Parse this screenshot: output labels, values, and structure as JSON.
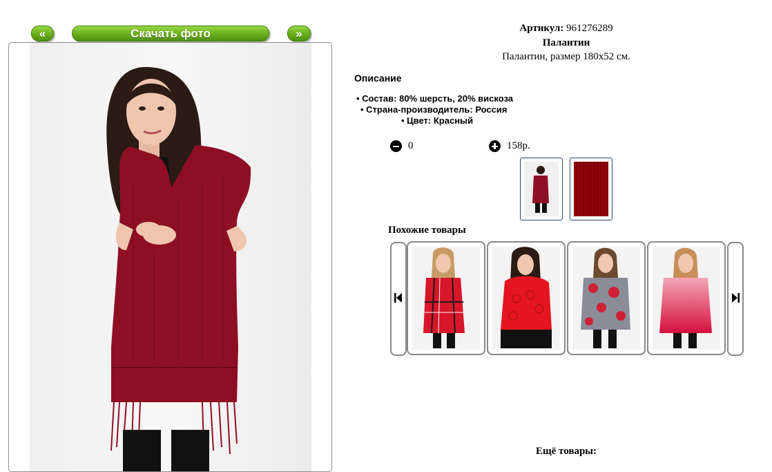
{
  "nav": {
    "prev_label": "«",
    "download_label": "Скачать фото",
    "next_label": "»"
  },
  "product": {
    "article_label": "Артикул:",
    "article_value": "961276289",
    "title": "Палантин",
    "subtitle": "Палантин, размер 180х52 см."
  },
  "description": {
    "heading": "Описание",
    "items": [
      "Состав: 80% шерсть, 20% вискоза",
      "Страна-производитель: Россия",
      "Цвет: Красный"
    ]
  },
  "order": {
    "quantity": "0",
    "price": "158р."
  },
  "similar": {
    "heading": "Похожие товары",
    "items": [
      {
        "image": "red-plaid-scarf-photo"
      },
      {
        "image": "red-lace-scarf-photo"
      },
      {
        "image": "floral-scarf-photo"
      },
      {
        "image": "pink-gradient-scarf-photo"
      }
    ]
  },
  "more_label": "Ещё товары:",
  "colors": {
    "button_green": "#6fb51e",
    "scarf_red": "#8e0f24",
    "pink_scarf": "#e13a5e"
  }
}
